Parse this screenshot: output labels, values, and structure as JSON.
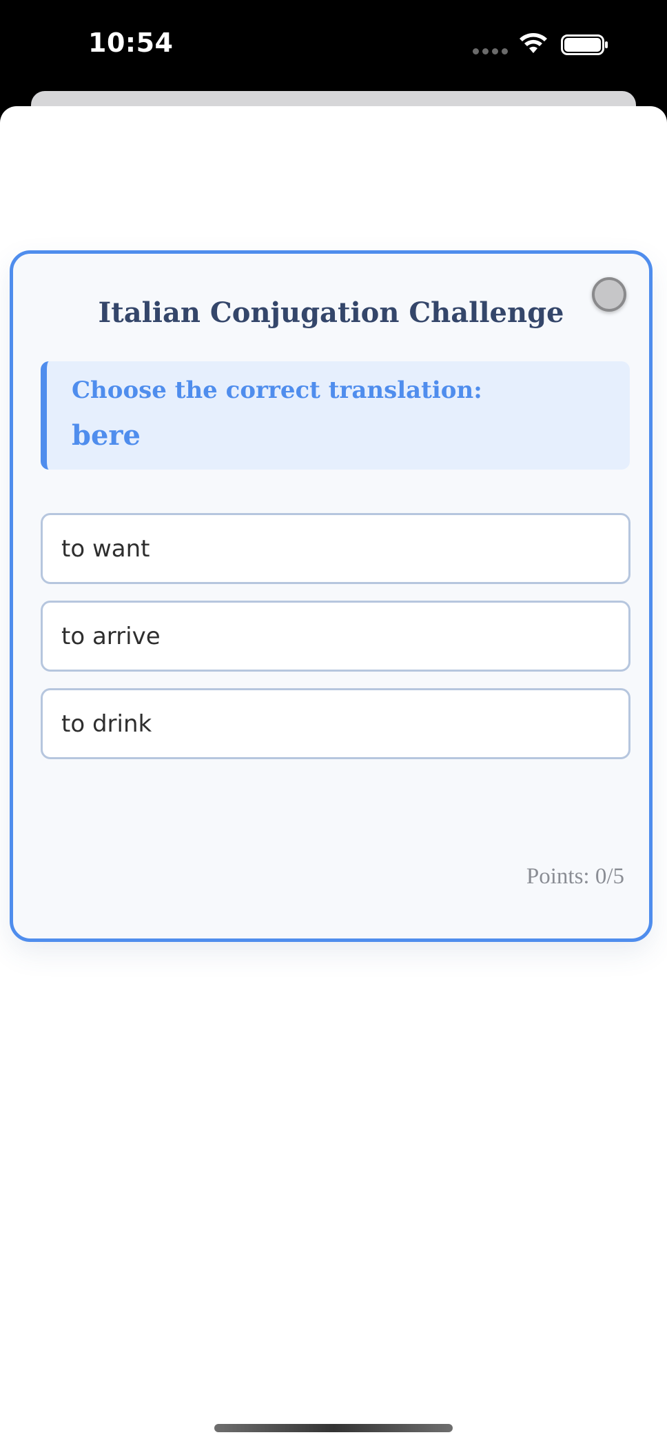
{
  "status_bar": {
    "time": "10:54"
  },
  "card": {
    "title": "Italian Conjugation Challenge",
    "prompt": {
      "instruction": "Choose the correct translation:",
      "word": "bere"
    },
    "options": [
      {
        "label": "to want"
      },
      {
        "label": "to arrive"
      },
      {
        "label": "to drink"
      }
    ],
    "points_text": "Points: 0/5"
  },
  "icons": {
    "wifi": "wifi-icon",
    "battery": "battery-icon",
    "close": "close-icon"
  },
  "colors": {
    "accent": "#4f8ded",
    "title": "#34466a",
    "prompt_bg": "#e6effd",
    "option_border": "#b6c6de",
    "card_bg": "#f7f9fc"
  }
}
